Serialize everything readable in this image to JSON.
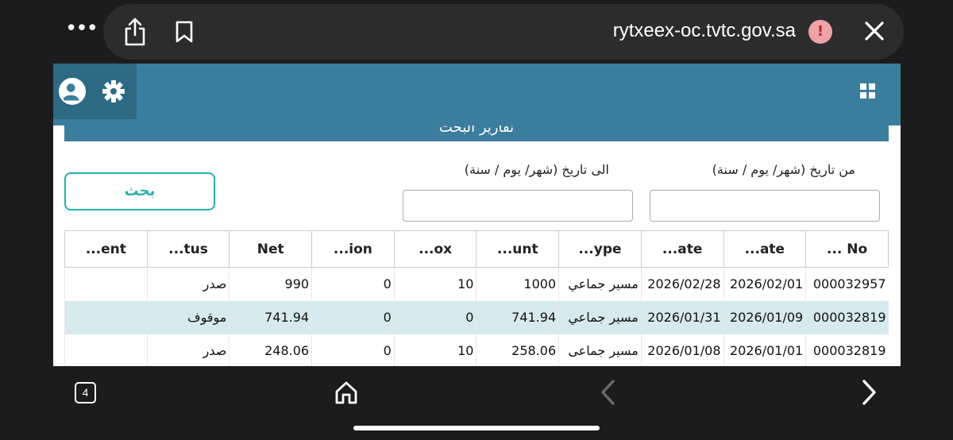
{
  "browser": {
    "url": "rytxeex-oc.tvtc.gov.sa",
    "more_glyph": "•••",
    "warning_glyph": "!",
    "tab_count": "4"
  },
  "page": {
    "section_title": "تقارير البحث",
    "search_button": "بحث",
    "from_date_label": "من تاريخ (شهر/ يوم / سنة)",
    "to_date_label": "الى تاريخ (شهر/ يوم / سنة)",
    "from_date_value": "",
    "to_date_value": ""
  },
  "table": {
    "headers": [
      "... No",
      "...ate",
      "...ate",
      "...ype",
      "...unt",
      "...ox",
      "...ion",
      "Net",
      "...tus",
      "...ent"
    ],
    "rows": [
      [
        "000032957",
        "2026/02/01",
        "2026/02/28",
        "مسير جماعي",
        "1000",
        "10",
        "0",
        "990",
        "صدر",
        ""
      ],
      [
        "000032819",
        "2026/01/09",
        "2026/01/31",
        "مسير جماعي",
        "741.94",
        "0",
        "0",
        "741.94",
        "موقوف",
        ""
      ],
      [
        "000032819",
        "2026/01/01",
        "2026/01/08",
        "مسير جماعى",
        "258.06",
        "10",
        "0",
        "248.06",
        "صدر",
        ""
      ]
    ]
  },
  "colors": {
    "header_blue": "#3b7d9c",
    "accent_teal": "#25b3a8",
    "row_alt": "#d6e9ee"
  },
  "icons": [
    "more-icon",
    "share-icon",
    "bookmark-icon",
    "warning-icon",
    "close-icon",
    "avatar-icon",
    "gear-icon",
    "grid-icon",
    "tabs-icon",
    "home-icon",
    "back-icon",
    "forward-icon"
  ]
}
